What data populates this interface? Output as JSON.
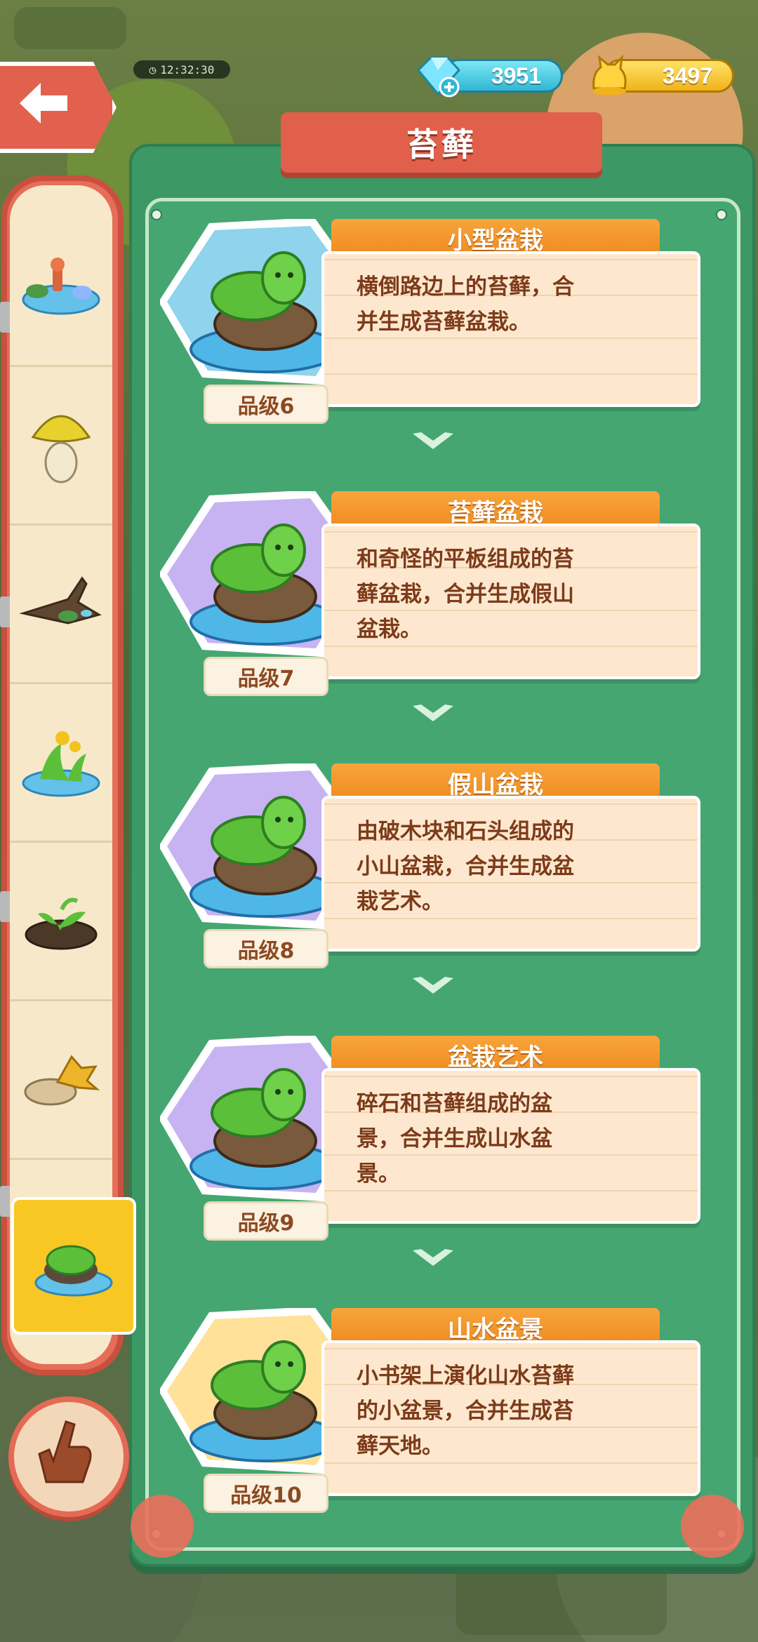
{
  "hud": {
    "timer": "12:32:30",
    "gems": "3951",
    "coins": "3497",
    "gem_color": "#2fb7d4",
    "coin_color": "#f0b21a"
  },
  "panel": {
    "title": "苔藓"
  },
  "sidebar": {
    "items": [
      {
        "icon": "fountain-pond-icon"
      },
      {
        "icon": "mushroom-icon"
      },
      {
        "icon": "driftwood-icon"
      },
      {
        "icon": "yellow-flower-pond-icon"
      },
      {
        "icon": "sprout-soil-icon"
      },
      {
        "icon": "leaf-rock-icon"
      },
      {
        "icon": "moss-pond-icon",
        "active": true
      }
    ]
  },
  "items": [
    {
      "name": "小型盆栽",
      "lines": [
        "横倒路边上的苔藓，合",
        "并生成苔藓盆栽。"
      ],
      "grade": "品级6",
      "bg": "#8fd3ec"
    },
    {
      "name": "苔藓盆栽",
      "lines": [
        "和奇怪的平板组成的苔",
        "藓盆栽，合并生成假山",
        "盆栽。"
      ],
      "grade": "品级7",
      "bg": "#c7b3f2"
    },
    {
      "name": "假山盆栽",
      "lines": [
        "由破木块和石头组成的",
        "小山盆栽，合并生成盆",
        "栽艺术。"
      ],
      "grade": "品级8",
      "bg": "#c7b3f2"
    },
    {
      "name": "盆栽艺术",
      "lines": [
        "碎石和苔藓组成的盆",
        "景，合并生成山水盆",
        "景。"
      ],
      "grade": "品级9",
      "bg": "#c7b3f2"
    },
    {
      "name": "山水盆景",
      "lines": [
        "小书架上演化山水苔藓",
        "的小盆景，合并生成苔",
        "藓天地。"
      ],
      "grade": "品级10",
      "bg": "#ffe19a"
    }
  ]
}
